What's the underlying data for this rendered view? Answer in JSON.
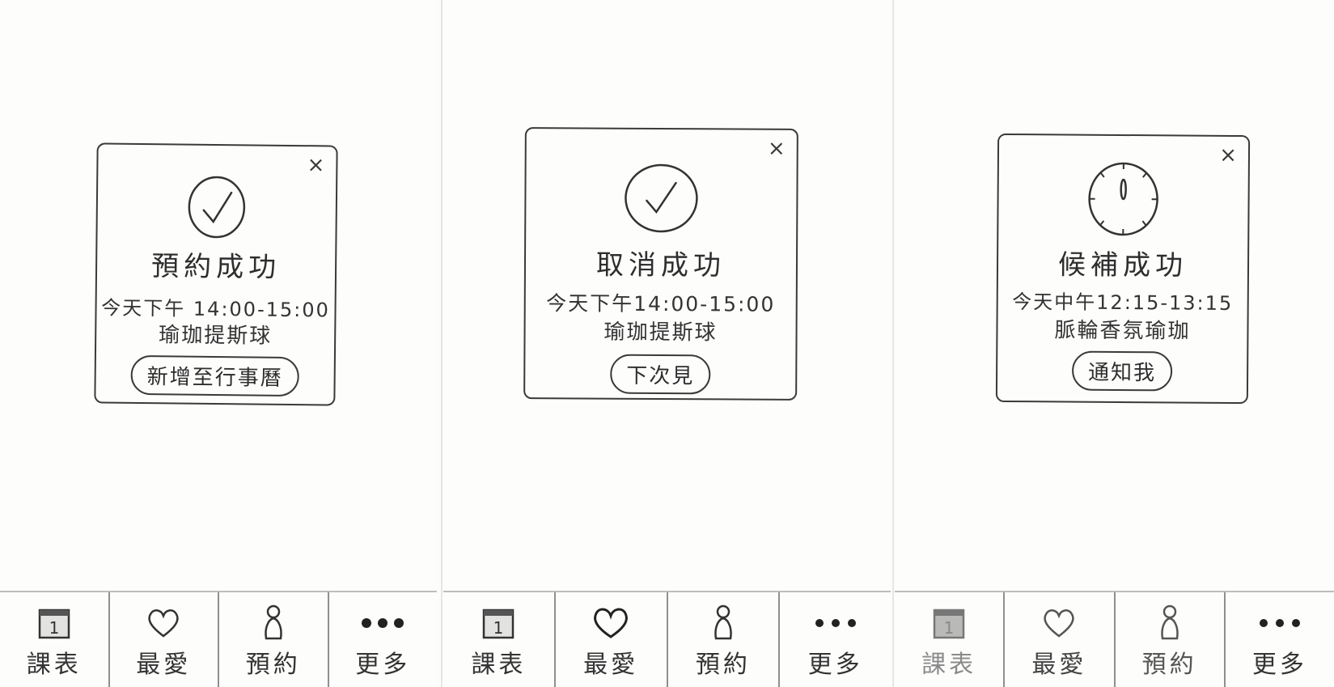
{
  "screens": [
    {
      "dialog": {
        "close_label": "×",
        "status_icon": "check-circle-icon",
        "title": "預約成功",
        "line1": "今天下午 14:00-15:00",
        "line2": "瑜珈提斯球",
        "button_label": "新增至行事曆"
      }
    },
    {
      "dialog": {
        "close_label": "×",
        "status_icon": "check-circle-icon",
        "title": "取消成功",
        "line1": "今天下午14:00-15:00",
        "line2": "瑜珈提斯球",
        "button_label": "下次見"
      }
    },
    {
      "dialog": {
        "close_label": "×",
        "status_icon": "clock-icon",
        "title": "候補成功",
        "line1": "今天中午12:15-13:15",
        "line2": "脈輪香氛瑜珈",
        "button_label": "通知我"
      }
    }
  ],
  "tabbar": {
    "tabs": [
      {
        "icon": "calendar-icon",
        "icon_text": "1",
        "label": "課表"
      },
      {
        "icon": "heart-icon",
        "label": "最愛"
      },
      {
        "icon": "person-icon",
        "label": "預約"
      },
      {
        "icon": "more-dots-icon",
        "label": "更多"
      }
    ]
  }
}
